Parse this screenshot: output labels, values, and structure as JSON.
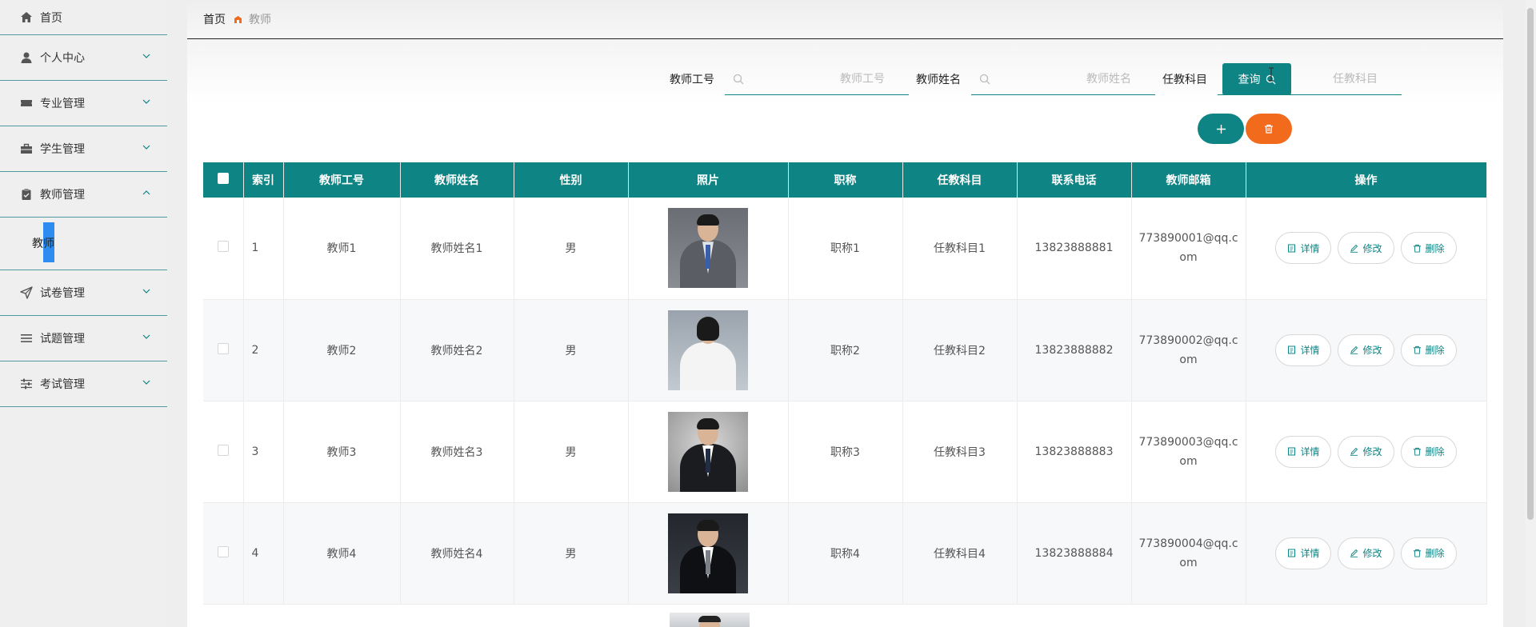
{
  "sidebar": {
    "items": [
      {
        "label": "首页",
        "icon": "home-icon"
      },
      {
        "label": "个人中心",
        "icon": "user-icon"
      },
      {
        "label": "专业管理",
        "icon": "ticket-icon"
      },
      {
        "label": "学生管理",
        "icon": "briefcase-icon"
      },
      {
        "label": "教师管理",
        "icon": "clipboard-icon"
      },
      {
        "label": "试卷管理",
        "icon": "send-icon"
      },
      {
        "label": "试题管理",
        "icon": "list-icon"
      },
      {
        "label": "考试管理",
        "icon": "sliders-icon"
      }
    ],
    "submenu_item": "教师",
    "accent": "#2d8cf0"
  },
  "breadcrumb": {
    "home": "首页",
    "current": "教师"
  },
  "search": {
    "fields": [
      {
        "label": "教师工号",
        "placeholder": "教师工号"
      },
      {
        "label": "教师姓名",
        "placeholder": "教师姓名"
      },
      {
        "label": "任教科目",
        "placeholder": "任教科目"
      }
    ],
    "query_label": "查询"
  },
  "colors": {
    "primary": "#0e8484",
    "danger": "#f26a1b"
  },
  "table": {
    "headers": [
      "索引",
      "教师工号",
      "教师姓名",
      "性别",
      "照片",
      "职称",
      "任教科目",
      "联系电话",
      "教师邮箱",
      "操作"
    ],
    "rows": [
      {
        "index": "1",
        "no": "教师1",
        "name": "教师姓名1",
        "gender": "男",
        "title": "职称1",
        "subject": "任教科目1",
        "phone": "13823888881",
        "email": "773890001@qq.com"
      },
      {
        "index": "2",
        "no": "教师2",
        "name": "教师姓名2",
        "gender": "男",
        "title": "职称2",
        "subject": "任教科目2",
        "phone": "13823888882",
        "email": "773890002@qq.com"
      },
      {
        "index": "3",
        "no": "教师3",
        "name": "教师姓名3",
        "gender": "男",
        "title": "职称3",
        "subject": "任教科目3",
        "phone": "13823888883",
        "email": "773890003@qq.com"
      },
      {
        "index": "4",
        "no": "教师4",
        "name": "教师姓名4",
        "gender": "男",
        "title": "职称4",
        "subject": "任教科目4",
        "phone": "13823888884",
        "email": "773890004@qq.com"
      }
    ],
    "actions": {
      "detail": "详情",
      "edit": "修改",
      "delete": "删除"
    }
  }
}
